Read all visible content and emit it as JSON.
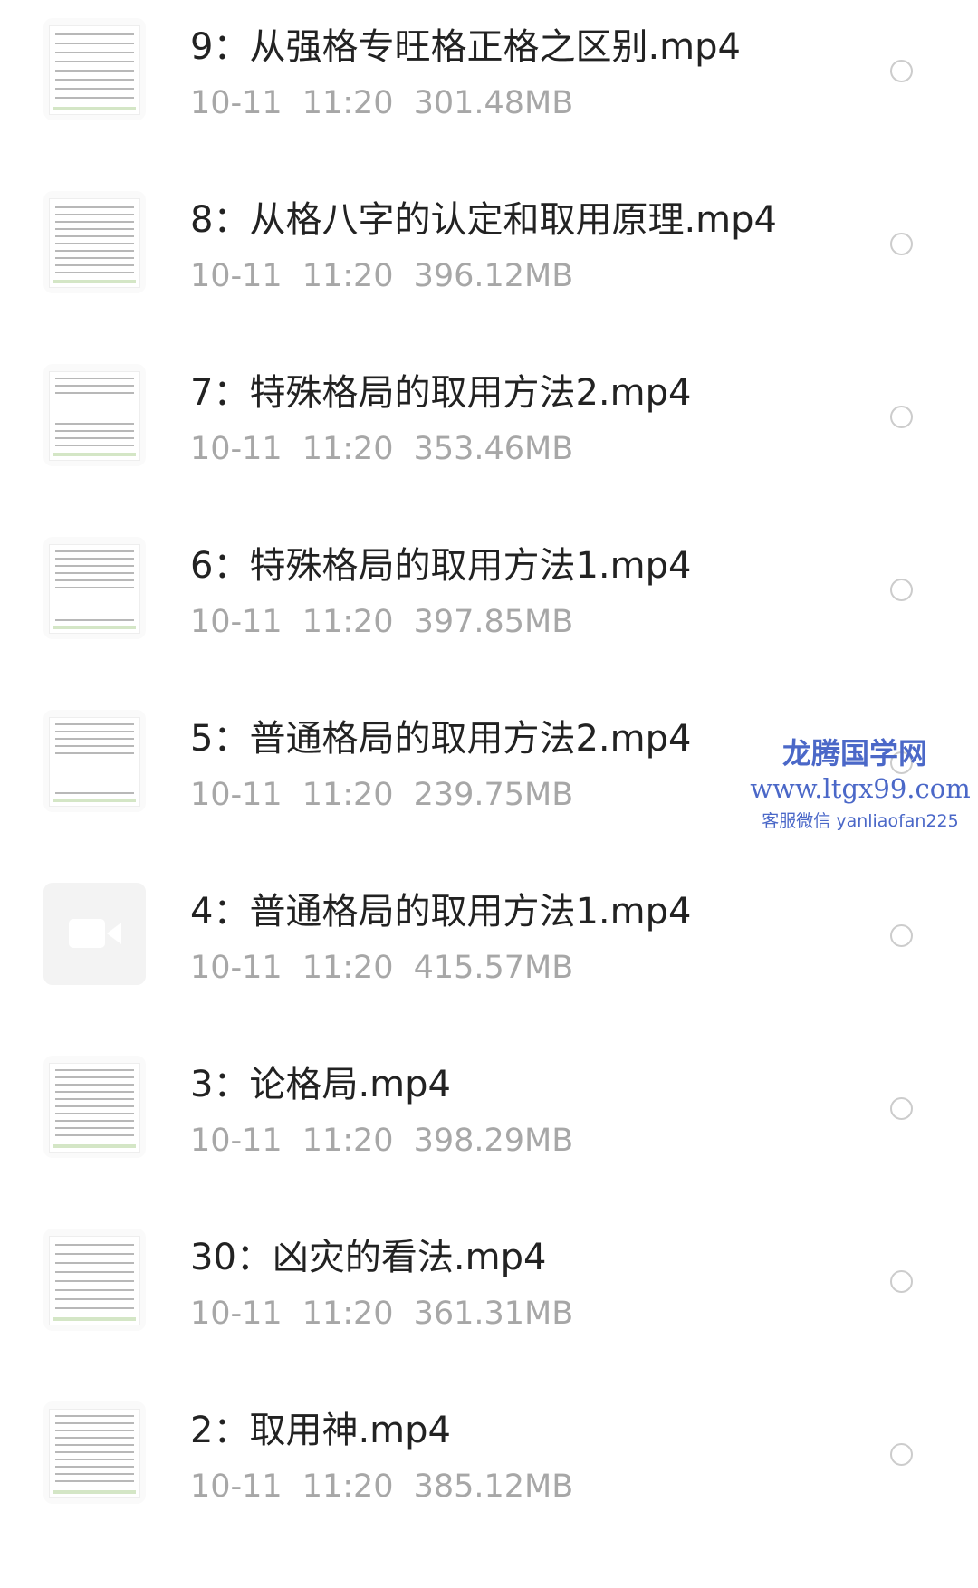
{
  "files": [
    {
      "name": "9：从强格专旺格正格之区别.mp4",
      "date": "10-11",
      "time": "11:20",
      "size": "301.48MB",
      "thumbnail_icon": "document-preview"
    },
    {
      "name": "8：从格八字的认定和取用原理.mp4",
      "date": "10-11",
      "time": "11:20",
      "size": "396.12MB",
      "thumbnail_icon": "document-preview"
    },
    {
      "name": "7：特殊格局的取用方法2.mp4",
      "date": "10-11",
      "time": "11:20",
      "size": "353.46MB",
      "thumbnail_icon": "document-preview"
    },
    {
      "name": "6：特殊格局的取用方法1.mp4",
      "date": "10-11",
      "time": "11:20",
      "size": "397.85MB",
      "thumbnail_icon": "document-preview"
    },
    {
      "name": "5：普通格局的取用方法2.mp4",
      "date": "10-11",
      "time": "11:20",
      "size": "239.75MB",
      "thumbnail_icon": "document-preview"
    },
    {
      "name": "4：普通格局的取用方法1.mp4",
      "date": "10-11",
      "time": "11:20",
      "size": "415.57MB",
      "thumbnail_icon": "video-camera-icon"
    },
    {
      "name": "3：论格局.mp4",
      "date": "10-11",
      "time": "11:20",
      "size": "398.29MB",
      "thumbnail_icon": "document-preview"
    },
    {
      "name": "30：凶灾的看法.mp4",
      "date": "10-11",
      "time": "11:20",
      "size": "361.31MB",
      "thumbnail_icon": "document-preview"
    },
    {
      "name": "2：取用神.mp4",
      "date": "10-11",
      "time": "11:20",
      "size": "385.12MB",
      "thumbnail_icon": "document-preview"
    }
  ],
  "watermark": {
    "title": "龙腾国学网",
    "url": "www.ltgx99.com",
    "contact": "客服微信 yanliaofan225"
  },
  "colors": {
    "title_text": "#222222",
    "meta_text": "#a7a7a7",
    "radio_border": "#cccccc",
    "watermark": "#4b68c8"
  }
}
